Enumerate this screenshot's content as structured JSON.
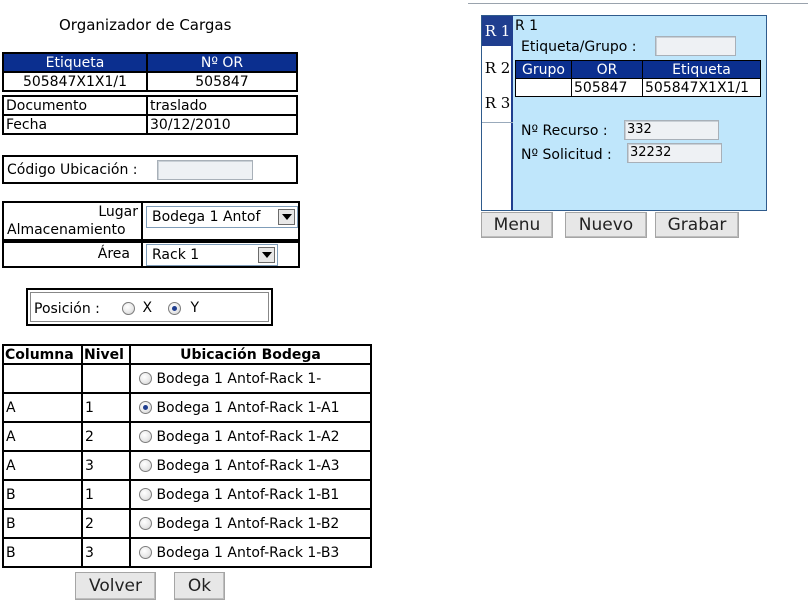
{
  "page": {
    "title": "Organizador de Cargas"
  },
  "item_table": {
    "headers": [
      "Etiqueta",
      "Nº OR"
    ],
    "values": [
      "505847X1X1/1",
      "505847"
    ]
  },
  "doc_table": {
    "rows": [
      {
        "label": "Documento",
        "value": "traslado"
      },
      {
        "label": "Fecha",
        "value": "30/12/2010"
      }
    ]
  },
  "codigo": {
    "label": "Código Ubicación :",
    "value": ""
  },
  "storage": {
    "lugar_label_line1": "Lugar",
    "lugar_label_line2": "Almacenamiento",
    "lugar_value": "Bodega 1 Antof",
    "area_label": "Área",
    "area_value": "Rack 1"
  },
  "posicion": {
    "label": "Posición :",
    "options": [
      "X",
      "Y"
    ],
    "selected": "Y"
  },
  "ubicacion_table": {
    "headers": [
      "Columna",
      "Nivel",
      "Ubicación Bodega"
    ],
    "rows": [
      {
        "columna": "",
        "nivel": "",
        "ubicacion": "Bodega 1 Antof-Rack 1-",
        "selected": false
      },
      {
        "columna": "A",
        "nivel": "1",
        "ubicacion": "Bodega 1 Antof-Rack 1-A1",
        "selected": true
      },
      {
        "columna": "A",
        "nivel": "2",
        "ubicacion": "Bodega 1 Antof-Rack 1-A2",
        "selected": false
      },
      {
        "columna": "A",
        "nivel": "3",
        "ubicacion": "Bodega 1 Antof-Rack 1-A3",
        "selected": false
      },
      {
        "columna": "B",
        "nivel": "1",
        "ubicacion": "Bodega 1 Antof-Rack 1-B1",
        "selected": false
      },
      {
        "columna": "B",
        "nivel": "2",
        "ubicacion": "Bodega 1 Antof-Rack 1-B2",
        "selected": false
      },
      {
        "columna": "B",
        "nivel": "3",
        "ubicacion": "Bodega 1 Antof-Rack 1-B3",
        "selected": false
      }
    ]
  },
  "bottom_buttons": {
    "volver": "Volver",
    "ok": "Ok"
  },
  "right_panel": {
    "tabs": [
      "R 1",
      "R 2",
      "R 3"
    ],
    "active_tab": "R 1",
    "heading": "R 1",
    "etiqueta_grupo_label": "Etiqueta/Grupo :",
    "etiqueta_grupo_value": "",
    "table_headers": [
      "Grupo",
      "OR",
      "Etiqueta"
    ],
    "table_row": [
      "",
      "505847",
      "505847X1X1/1"
    ],
    "recurso_label": "Nº Recurso :",
    "recurso_value": "332",
    "solicitud_label": "Nº Solicitud :",
    "solicitud_value": "32232",
    "buttons": [
      "Menu",
      "Nuevo",
      "Grabar"
    ]
  },
  "colors": {
    "header_blue": "#0b2f8f",
    "panel_bg": "#bfe6fb",
    "tab_active": "#1f3e8f"
  }
}
